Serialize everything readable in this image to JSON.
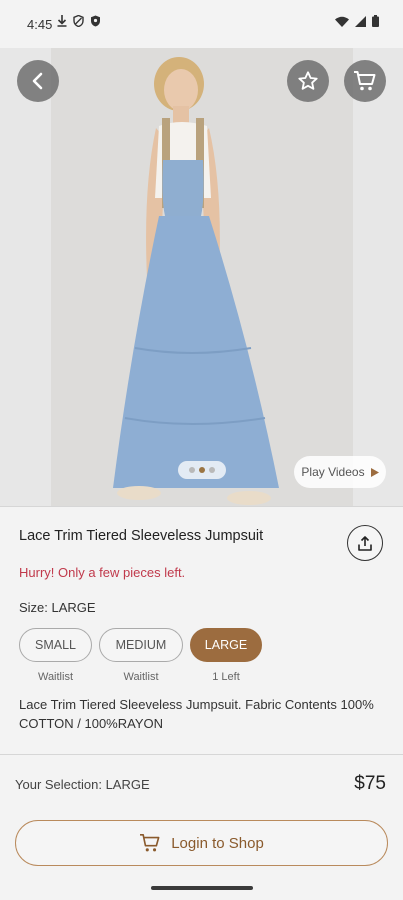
{
  "status_bar": {
    "time": "4:45",
    "left_icons": [
      "download-icon",
      "shield-icon",
      "vpn-icon"
    ],
    "right_icons": [
      "wifi-icon",
      "signal-icon",
      "battery-icon"
    ]
  },
  "hero": {
    "back_icon": "chevron-left-icon",
    "favorite_icon": "star-icon",
    "cart_icon": "cart-icon",
    "carousel_page": 2,
    "carousel_total": 3,
    "play_videos_label": "Play Videos"
  },
  "product": {
    "title": "Lace Trim Tiered Sleeveless Jumpsuit",
    "urgency": "Hurry! Only a few pieces left.",
    "size_label": "Size: LARGE",
    "sizes": [
      {
        "label": "SMALL",
        "status": "Waitlist"
      },
      {
        "label": "MEDIUM",
        "status": "Waitlist"
      },
      {
        "label": "LARGE",
        "status": "1 Left"
      }
    ],
    "description": "Lace Trim Tiered Sleeveless Jumpsuit. Fabric Contents 100% COTTON / 100%RAYON"
  },
  "footer": {
    "selection": "Your Selection: LARGE",
    "price": "$75",
    "login_label": "Login to Shop"
  },
  "colors": {
    "accent": "#9c6c3f",
    "urgency": "#c0394b",
    "button_outline": "#b98a5c"
  }
}
